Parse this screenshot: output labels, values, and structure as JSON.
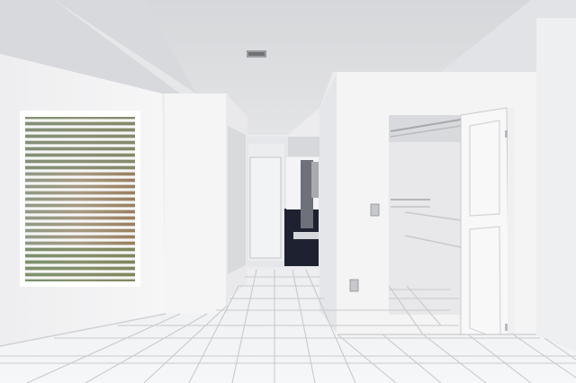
{
  "scene": {
    "description_visible_text": "",
    "colors": {
      "ceiling": "#dcdde0",
      "wall_light": "#f4f4f5",
      "wall_shade": "#e4e5e8",
      "floor": "#f1f2f3",
      "grout": "#c9cacc",
      "dark_tile": "#1e2230",
      "door": "#f7f7f7",
      "window_frame": "#ffffff"
    }
  }
}
